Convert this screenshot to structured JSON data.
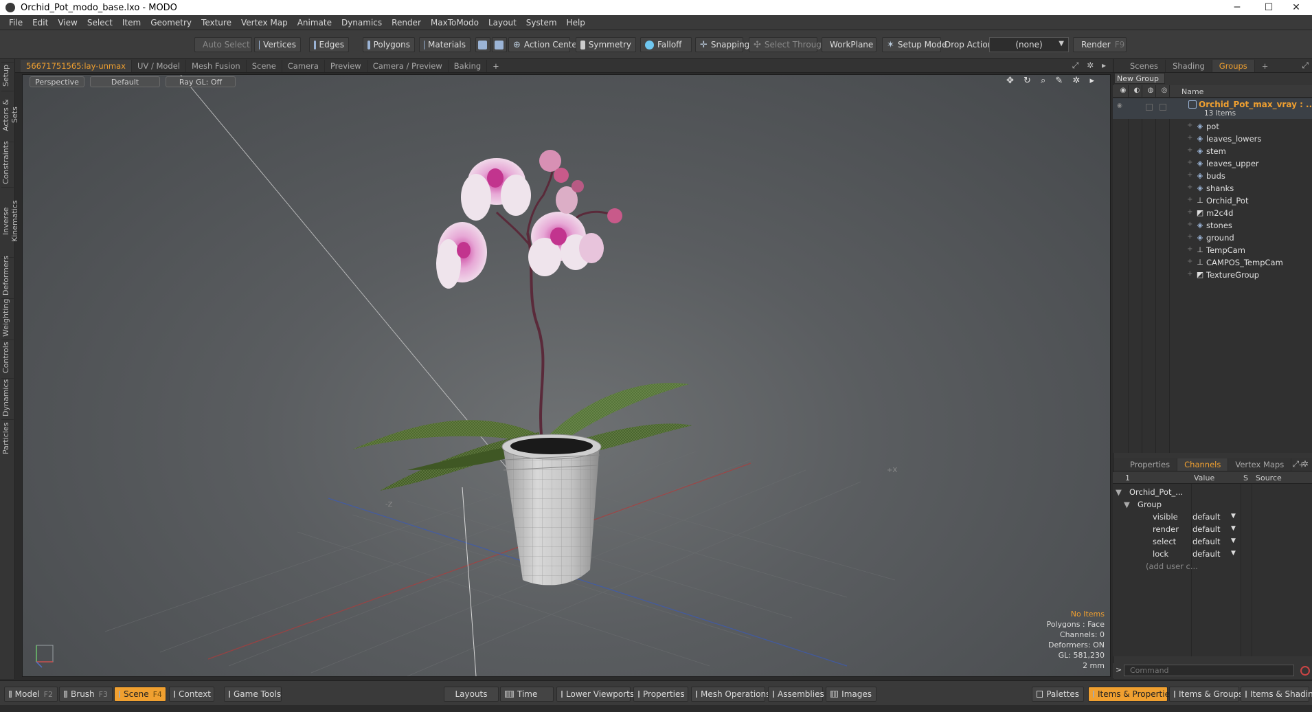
{
  "window": {
    "title": "Orchid_Pot_modo_base.lxo - MODO",
    "minimize": "─",
    "maximize": "☐",
    "close": "✕"
  },
  "menu": [
    "File",
    "Edit",
    "View",
    "Select",
    "Item",
    "Geometry",
    "Texture",
    "Vertex Map",
    "Animate",
    "Dynamics",
    "Render",
    "MaxToModo",
    "Layout",
    "System",
    "Help"
  ],
  "toolbar": {
    "auto_select": "Auto Select",
    "vertices": "Vertices",
    "edges": "Edges",
    "polygons": "Polygons",
    "materials": "Materials",
    "action_center": "Action Center",
    "symmetry": "Symmetry",
    "falloff": "Falloff",
    "snapping": "Snapping",
    "select_through": "Select Through",
    "workplane": "WorkPlane",
    "setup_mode": "Setup Mode",
    "drop_action_label": "Drop Action",
    "drop_action_value": "(none)",
    "render": "Render",
    "render_key": "F9"
  },
  "left_tabs": [
    "Setup",
    "Actors & Sets",
    "Constraints",
    "Inverse Kinematics",
    "Deformers",
    "Weighting",
    "Controls",
    "Dynamics",
    "Particles"
  ],
  "viewport_tabs": [
    {
      "label": "56671751565:lay-unmax",
      "active": true
    },
    {
      "label": "UV / Model",
      "active": false
    },
    {
      "label": "Mesh Fusion",
      "active": false
    },
    {
      "label": "Scene",
      "active": false
    },
    {
      "label": "Camera",
      "active": false
    },
    {
      "label": "Preview",
      "active": false
    },
    {
      "label": "Camera / Preview",
      "active": false
    },
    {
      "label": "Baking",
      "active": false
    }
  ],
  "viewport_tab_add": "+",
  "viewport": {
    "view": "Perspective",
    "shading": "Default",
    "raygl": "Ray GL: Off",
    "axis_x": "+X",
    "axis_z": "-Z",
    "info": {
      "items": "No Items",
      "polygons": "Polygons : Face",
      "channels": "Channels: 0",
      "deformers": "Deformers: ON",
      "gl": "GL: 581,230",
      "scale": "2 mm"
    }
  },
  "right_tabs_top": [
    {
      "label": "Scenes",
      "active": false
    },
    {
      "label": "Shading",
      "active": false
    },
    {
      "label": "Groups",
      "active": true
    }
  ],
  "groups": {
    "new_group": "New Group",
    "name_header": "Name",
    "group_name": "Orchid_Pot_max_vray : ...",
    "group_count": "13 Items",
    "items": [
      {
        "name": "pot",
        "icon": "mesh-icon"
      },
      {
        "name": "leaves_lowers",
        "icon": "mesh-icon"
      },
      {
        "name": "stem",
        "icon": "mesh-icon"
      },
      {
        "name": "leaves_upper",
        "icon": "mesh-icon"
      },
      {
        "name": "buds",
        "icon": "mesh-icon"
      },
      {
        "name": "shanks",
        "icon": "mesh-icon"
      },
      {
        "name": "Orchid_Pot",
        "icon": "locator-icon"
      },
      {
        "name": "m2c4d",
        "icon": "group-locator-icon"
      },
      {
        "name": "stones",
        "icon": "mesh-icon"
      },
      {
        "name": "ground",
        "icon": "mesh-icon"
      },
      {
        "name": "TempCam",
        "icon": "camera-icon"
      },
      {
        "name": "CAMPOS_TempCam",
        "icon": "locator-icon"
      },
      {
        "name": "TextureGroup",
        "icon": "group-locator-icon"
      }
    ]
  },
  "right_tabs_bottom": [
    {
      "label": "Properties",
      "active": false
    },
    {
      "label": "Channels",
      "active": true
    },
    {
      "label": "Vertex Maps",
      "active": false
    }
  ],
  "channels": {
    "col_index": "1",
    "col_value": "Value",
    "col_s": "S",
    "col_source": "Source",
    "root": "Orchid_Pot_...",
    "group": "Group",
    "rows": [
      {
        "name": "visible",
        "value": "default"
      },
      {
        "name": "render",
        "value": "default"
      },
      {
        "name": "select",
        "value": "default"
      },
      {
        "name": "lock",
        "value": "default"
      }
    ],
    "add_user": "(add user c..."
  },
  "command": {
    "placeholder": "Command",
    "prompt": ">"
  },
  "bottom": {
    "model": "Model",
    "model_key": "F2",
    "brush": "Brush",
    "brush_key": "F3",
    "scene": "Scene",
    "scene_key": "F4",
    "context": "Context",
    "game_tools": "Game Tools",
    "layouts": "Layouts",
    "time": "Time",
    "lower_viewports": "Lower Viewports",
    "properties": "Properties",
    "mesh_operations": "Mesh Operations",
    "assemblies": "Assemblies",
    "images": "Images",
    "palettes": "Palettes",
    "items_properties": "Items & Properties",
    "items_groups": "Items & Groups",
    "items_shading": "Items & Shading"
  },
  "colors": {
    "accent": "#f0a030",
    "panel": "#353535",
    "viewport": "#5a5d60"
  }
}
